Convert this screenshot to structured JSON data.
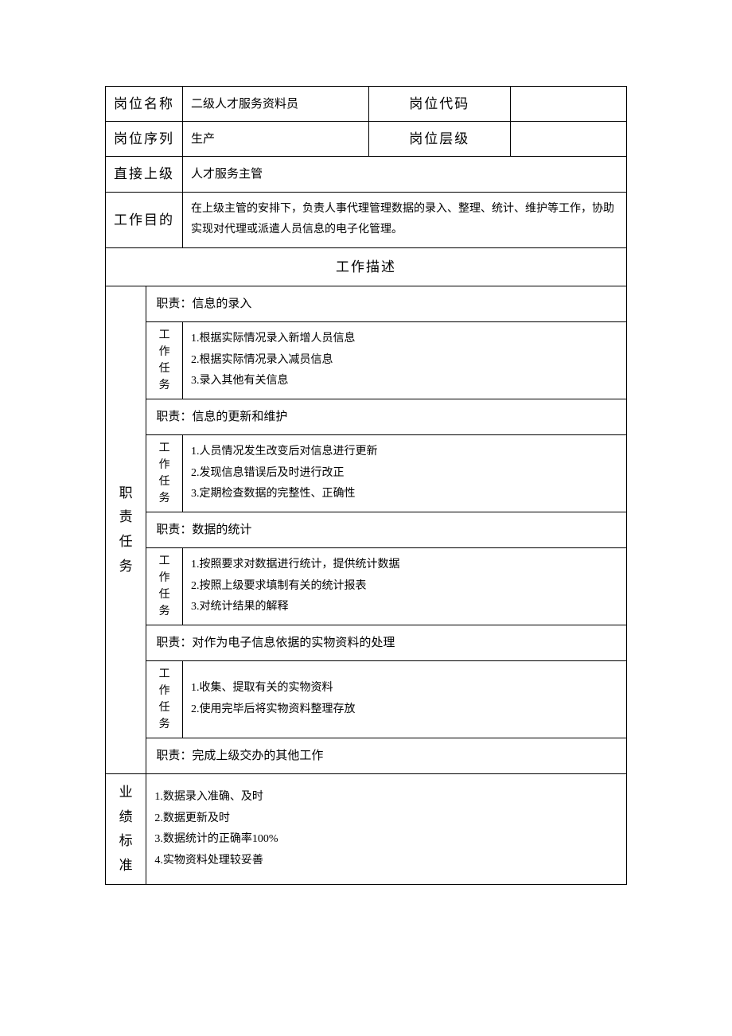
{
  "header": {
    "position_name_label": "岗位名称",
    "position_name_value": "二级人才服务资料员",
    "position_code_label": "岗位代码",
    "position_code_value": "",
    "position_series_label": "岗位序列",
    "position_series_value": "生产",
    "position_level_label": "岗位层级",
    "position_level_value": "",
    "direct_superior_label": "直接上级",
    "direct_superior_value": "人才服务主管",
    "work_purpose_label": "工作目的",
    "work_purpose_value": "在上级主管的安排下，负责人事代理管理数据的录入、整理、统计、维护等工作，协助实现对代理或派遣人员信息的电子化管理。"
  },
  "work_description_title": "工作描述",
  "sidebar": {
    "duties_label_chars": [
      "职",
      "责",
      "任",
      "务"
    ],
    "standards_label_chars": [
      "业",
      "绩",
      "标",
      "准"
    ]
  },
  "task_label_chars": [
    "工",
    "作",
    "任",
    "务"
  ],
  "duty_prefix": "职责：",
  "duties": [
    {
      "title": "信息的录入",
      "tasks": "1.根据实际情况录入新增人员信息\n2.根据实际情况录入减员信息\n3.录入其他有关信息"
    },
    {
      "title": "信息的更新和维护",
      "tasks": "1.人员情况发生改变后对信息进行更新\n2.发现信息错误后及时进行改正\n3.定期检查数据的完整性、正确性"
    },
    {
      "title": "数据的统计",
      "tasks": "1.按照要求对数据进行统计，提供统计数据\n2.按照上级要求填制有关的统计报表\n3.对统计结果的解释"
    },
    {
      "title": "对作为电子信息依据的实物资料的处理",
      "tasks": "1.收集、提取有关的实物资料\n2.使用完毕后将实物资料整理存放"
    },
    {
      "title": "完成上级交办的其他工作",
      "tasks": null
    }
  ],
  "standards": "1.数据录入准确、及时\n2.数据更新及时\n3.数据统计的正确率100%\n4.实物资料处理较妥善"
}
